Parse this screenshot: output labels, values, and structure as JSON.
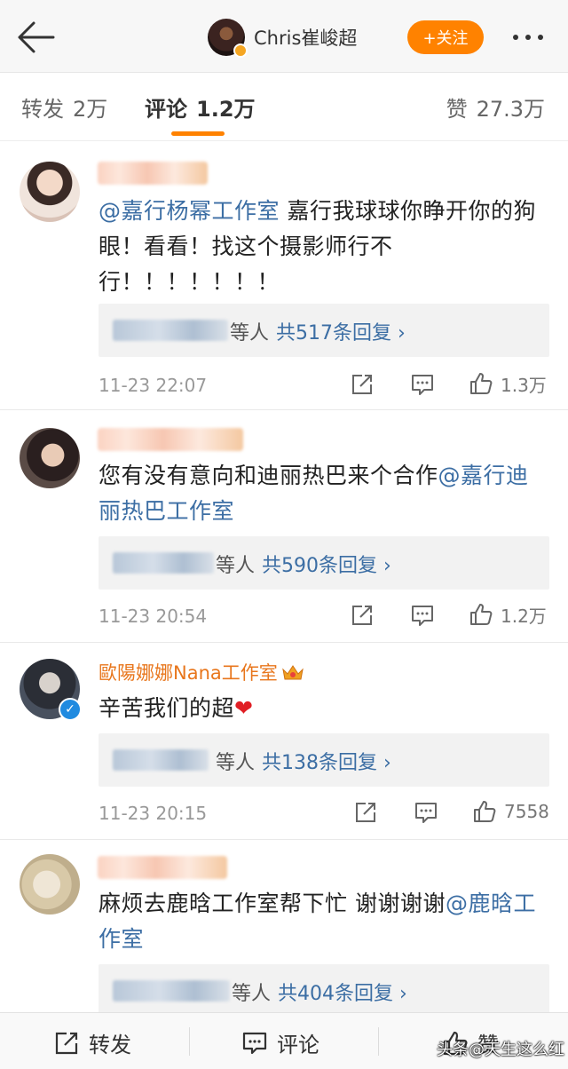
{
  "header": {
    "profile_name": "Chris崔峻超",
    "follow_label": "+关注"
  },
  "tabs": {
    "repost_label": "转发",
    "repost_count": "2万",
    "comment_label": "评论",
    "comment_count": "1.2万",
    "like_label": "赞",
    "like_count": "27.3万"
  },
  "comments": [
    {
      "mention": "@嘉行杨幂工作室",
      "text": " 嘉行我球球你睁开你的狗眼！看看！找这个摄影师行不行！！！！！！！",
      "reply_suffix": "等人",
      "reply_count_label": "共517条回复 ›",
      "time": "11-23 22:07",
      "likes": "1.3万"
    },
    {
      "text": "您有没有意向和迪丽热巴来个合作",
      "mention": "@嘉行迪丽热巴工作室",
      "reply_suffix": "等人",
      "reply_count_label": "共590条回复 ›",
      "time": "11-23 20:54",
      "likes": "1.2万"
    },
    {
      "name": "歐陽娜娜Nana工作室",
      "text": "辛苦我们的超",
      "emoji": "❤",
      "reply_suffix": "等人",
      "reply_count_label": "共138条回复 ›",
      "time": "11-23 20:15",
      "likes": "7558"
    },
    {
      "text": "麻烦去鹿晗工作室帮下忙 谢谢谢谢",
      "mention": "@鹿晗工作室",
      "reply_suffix": "等人",
      "reply_count_label": "共404条回复 ›"
    }
  ],
  "bottombar": {
    "repost_label": "转发",
    "comment_label": "评论",
    "like_label": "赞"
  },
  "watermark": "头条@天生这么红",
  "colors": {
    "accent": "#ff8200",
    "link": "#3c6ea4",
    "vip_name": "#e8761c"
  },
  "icons": [
    "back-arrow-icon",
    "more-icon",
    "share-icon",
    "comment-icon",
    "like-icon",
    "verified-icon",
    "crown-icon",
    "heart-icon"
  ]
}
